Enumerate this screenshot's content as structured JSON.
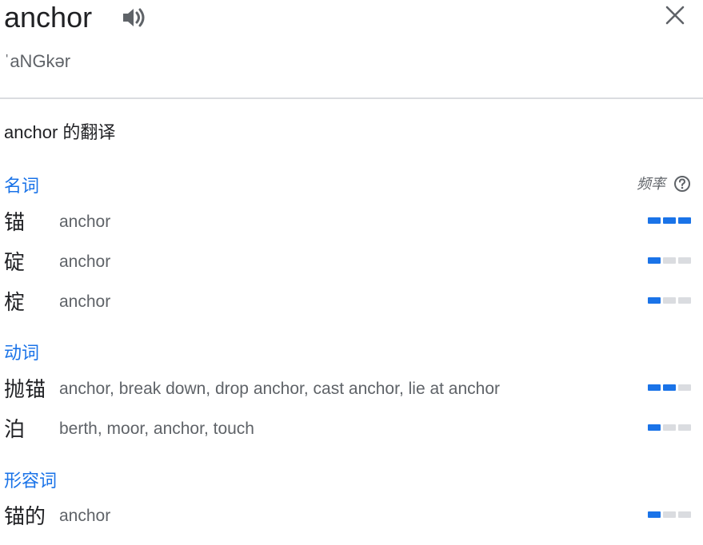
{
  "header": {
    "word": "anchor",
    "phonetic": "ˈaNGkər",
    "speaker_icon": "volume-icon",
    "close_icon": "close-icon"
  },
  "translations_heading": "anchor 的翻译",
  "frequency_label": "频率",
  "help_icon": "help-circle-icon",
  "colors": {
    "accent": "#1a73e8",
    "bar_off": "#dadce0",
    "text": "#202124",
    "muted": "#5f6368"
  },
  "sections": [
    {
      "pos": "名词",
      "rows": [
        {
          "term": "锚",
          "translations": "anchor",
          "frequency": 3
        },
        {
          "term": "碇",
          "translations": "anchor",
          "frequency": 1
        },
        {
          "term": "椗",
          "translations": "anchor",
          "frequency": 1
        }
      ]
    },
    {
      "pos": "动词",
      "rows": [
        {
          "term": "抛锚",
          "translations": "anchor, break down, drop anchor, cast anchor, lie at anchor",
          "frequency": 2
        },
        {
          "term": "泊",
          "translations": "berth, moor, anchor, touch",
          "frequency": 1
        }
      ]
    },
    {
      "pos": "形容词",
      "rows": [
        {
          "term": "锚的",
          "translations": "anchor",
          "frequency": 1
        }
      ]
    }
  ]
}
